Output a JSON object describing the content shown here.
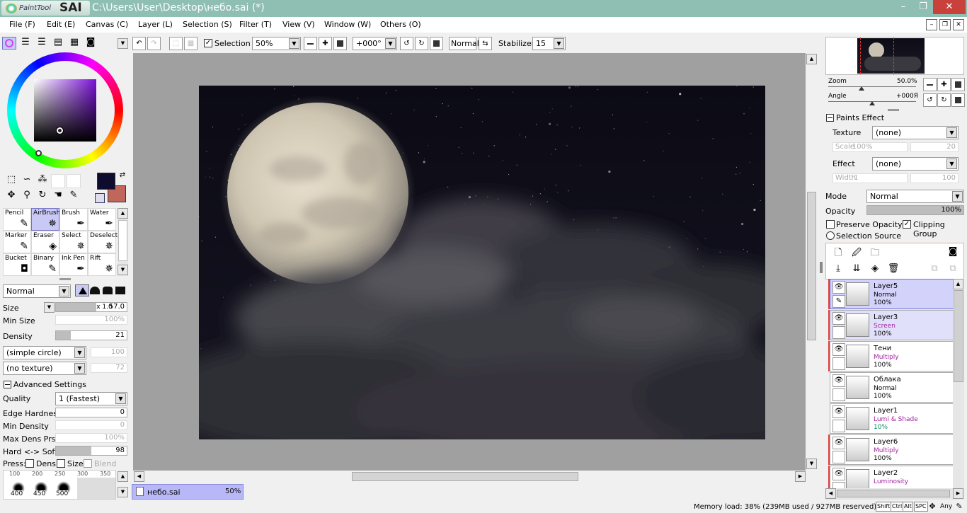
{
  "window": {
    "app_logo_small": "PaintTool",
    "app_logo_big": "SAI",
    "title": "C:\\Users\\User\\Desktop\\небо.sai (*)",
    "minimize": "–",
    "maximize": "❐",
    "close": "✕"
  },
  "menu": {
    "items": [
      "File (F)",
      "Edit (E)",
      "Canvas (C)",
      "Layer (L)",
      "Selection (S)",
      "Filter (T)",
      "View (V)",
      "Window (W)",
      "Others (O)"
    ],
    "mdi": [
      "–",
      "❐",
      "✕"
    ]
  },
  "toolbar": {
    "selection_label": "Selection",
    "selection_checked": "✓",
    "zoom": "50%",
    "rotation": "+000°",
    "blend": "Normal",
    "stabilizer_label": "Stabilizer",
    "stabilizer_value": "15"
  },
  "colors": {
    "primary": "#0e0c2e",
    "secondary": "#c0665a",
    "accent": "#9292f0",
    "selection": "#c9c9f5"
  },
  "tools": {
    "tiles": [
      {
        "label": "Pencil",
        "icon": "pencil-icon",
        "glyph": "✎"
      },
      {
        "label": "AirBrush",
        "icon": "airbrush-icon",
        "glyph": "✵"
      },
      {
        "label": "Brush",
        "icon": "brush-icon",
        "glyph": "✒"
      },
      {
        "label": "Water",
        "icon": "water-icon",
        "glyph": "✒"
      },
      {
        "label": "Marker",
        "icon": "marker-icon",
        "glyph": "✎"
      },
      {
        "label": "Eraser",
        "icon": "eraser-icon",
        "glyph": "◈"
      },
      {
        "label": "Select",
        "icon": "select-icon",
        "glyph": "✵"
      },
      {
        "label": "Deselect",
        "icon": "deselect-icon",
        "glyph": "✵"
      },
      {
        "label": "Bucket",
        "icon": "bucket-icon",
        "glyph": "◘"
      },
      {
        "label": "Binary",
        "icon": "binary-icon",
        "glyph": "✎"
      },
      {
        "label": "Ink Pen",
        "icon": "ink-pen-icon",
        "glyph": "✒"
      },
      {
        "label": "Rift",
        "icon": "rift-icon",
        "glyph": "✵"
      }
    ]
  },
  "brush": {
    "blend_mode": "Normal",
    "size_label": "Size",
    "size_multiplier": "x 1.0",
    "size_value": "57.0",
    "min_size_label": "Min Size",
    "min_size_value": "100%",
    "density_label": "Density",
    "density_value": "21",
    "shape": "(simple circle)",
    "shape_value": "100",
    "texture": "(no texture)",
    "texture_value": "72",
    "advanced_label": "Advanced Settings",
    "quality_label": "Quality",
    "quality_value": "1 (Fastest)",
    "edge_hardness_label": "Edge Hardness",
    "edge_hardness_value": "0",
    "min_density_label": "Min Density",
    "min_density_value": "0",
    "max_dens_label": "Max Dens Prs.",
    "max_dens_value": "100%",
    "hard_soft_label": "Hard <-> Soft",
    "hard_soft_value": "98",
    "press_label": "Press:",
    "press_dens": "Dens",
    "press_size": "Size",
    "press_blend": "Blend",
    "sizes_top": [
      "100",
      "200",
      "250",
      "300",
      "350"
    ],
    "sizes_bottom": [
      "400",
      "450",
      "500"
    ]
  },
  "navigator": {
    "zoom_label": "Zoom",
    "zoom_value": "50.0%",
    "angle_label": "Angle",
    "angle_value": "+000Я"
  },
  "paints_effect": {
    "header": "Paints Effect",
    "texture_label": "Texture",
    "texture_value": "(none)",
    "scale_label": "Scale",
    "scale_value": "100%",
    "scale_num": "20",
    "effect_label": "Effect",
    "effect_value": "(none)",
    "width_label": "Width",
    "width_value": "1",
    "width_num": "100"
  },
  "layer_props": {
    "mode_label": "Mode",
    "mode_value": "Normal",
    "opacity_label": "Opacity",
    "opacity_value": "100%",
    "preserve_opacity": "Preserve Opacity",
    "clipping_group": "Clipping Group",
    "selection_source": "Selection Source"
  },
  "layers": [
    {
      "name": "Layer5",
      "mode": "Normal",
      "opacity": "100%",
      "selected": true,
      "marked": true
    },
    {
      "name": "Layer3",
      "mode": "Screen",
      "opacity": "100%",
      "selected": false,
      "marked": true
    },
    {
      "name": "Тени",
      "mode": "Multiply",
      "opacity": "100%",
      "selected": false,
      "marked": true
    },
    {
      "name": "Облака",
      "mode": "Normal",
      "opacity": "100%",
      "selected": false,
      "marked": false
    },
    {
      "name": "Layer1",
      "mode": "Lumi & Shade",
      "opacity": "10%",
      "selected": false,
      "marked": false
    },
    {
      "name": "Layer6",
      "mode": "Multiply",
      "opacity": "100%",
      "selected": false,
      "marked": true
    },
    {
      "name": "Layer2",
      "mode": "Luminosity",
      "opacity": "",
      "selected": false,
      "marked": true
    }
  ],
  "document": {
    "name": "небо.sai",
    "zoom": "50%"
  },
  "status": {
    "memory": "Memory load: 38% (239MB used / 927MB reserved)",
    "keys": [
      "Shift",
      "Ctrl",
      "Alt",
      "SPC"
    ],
    "any": "Any"
  }
}
